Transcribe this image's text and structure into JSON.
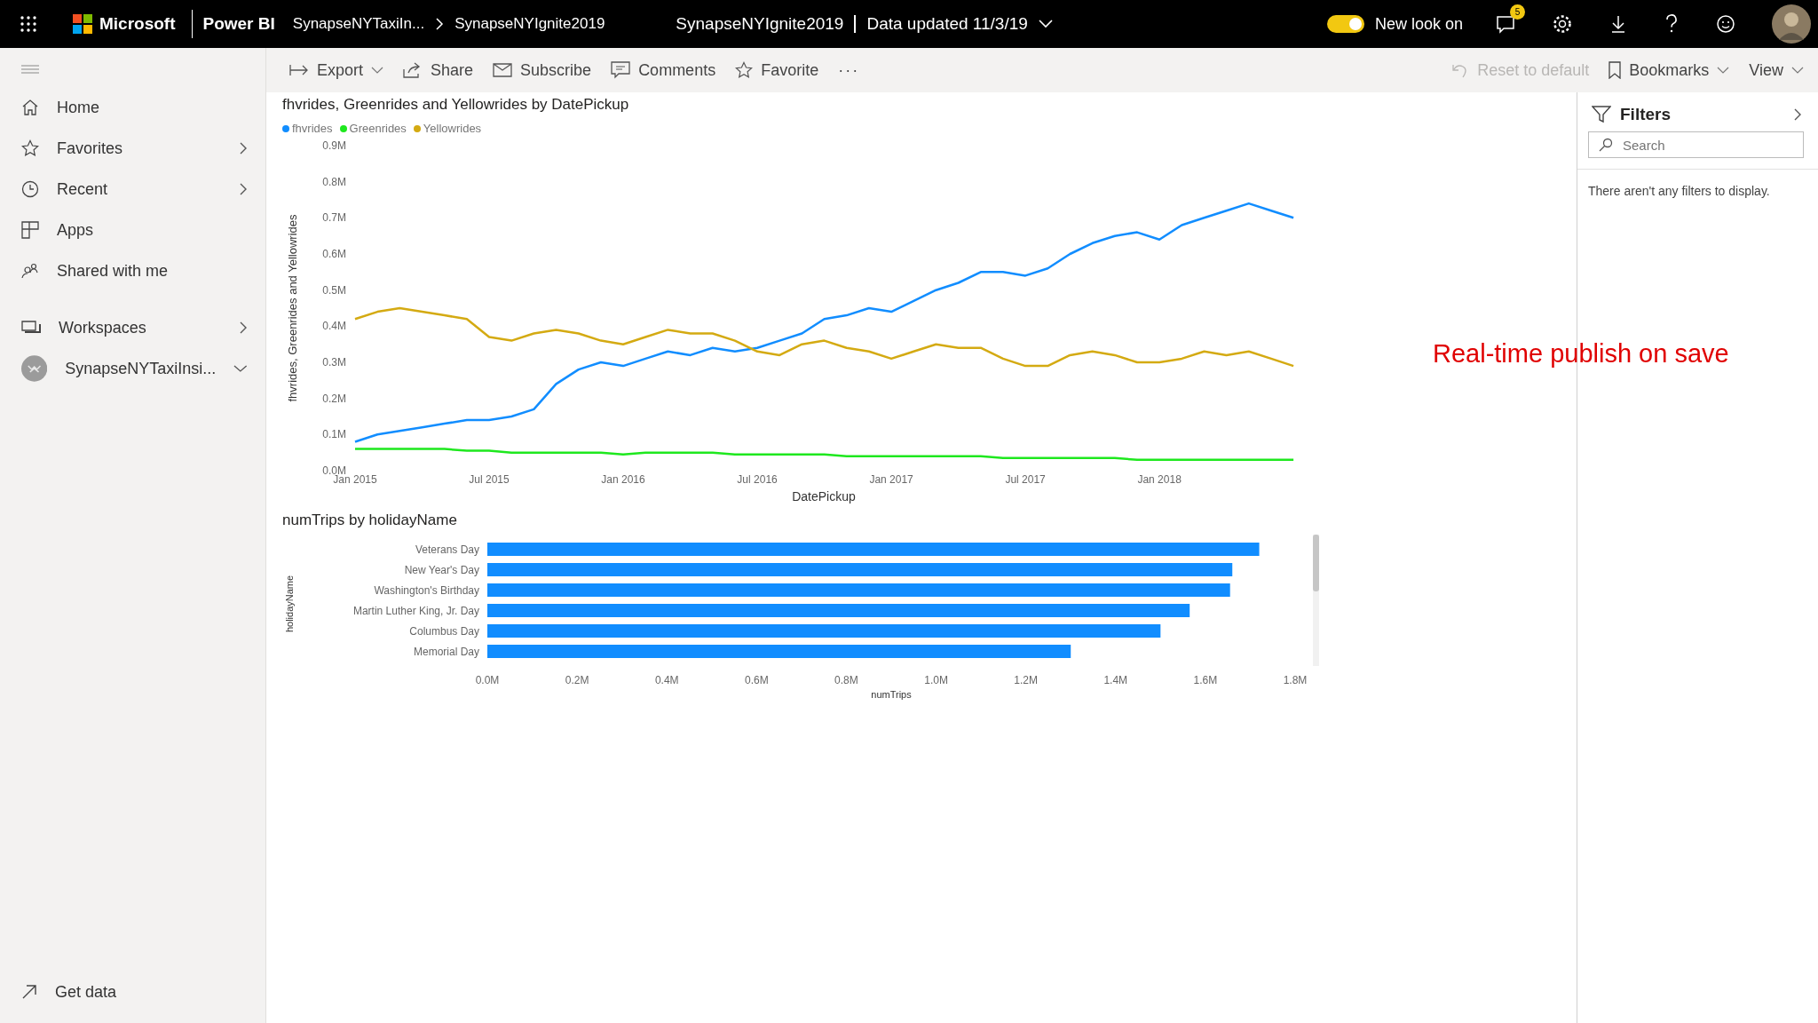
{
  "top_bar": {
    "brand": "Microsoft",
    "product": "Power BI",
    "breadcrumb": [
      "SynapseNYTaxiIn...",
      "SynapseNYIgnite2019"
    ],
    "report_title": "SynapseNYIgnite2019",
    "data_updated": "Data updated 11/3/19",
    "new_look": {
      "label": "New look on",
      "on": true
    },
    "notification_count": "5"
  },
  "sidebar": {
    "items": [
      {
        "label": "Home",
        "has_submenu": false
      },
      {
        "label": "Favorites",
        "has_submenu": true
      },
      {
        "label": "Recent",
        "has_submenu": true
      },
      {
        "label": "Apps",
        "has_submenu": false
      },
      {
        "label": "Shared with me",
        "has_submenu": false
      }
    ],
    "workspaces": {
      "label": "Workspaces",
      "has_submenu": true
    },
    "current_workspace": {
      "label": "SynapseNYTaxiInsi...",
      "expanded": true
    },
    "footer": "Get data"
  },
  "toolbar": {
    "actions": [
      {
        "label": "Export",
        "dropdown": true
      },
      {
        "label": "Share",
        "dropdown": false
      },
      {
        "label": "Subscribe",
        "dropdown": false
      },
      {
        "label": "Comments",
        "dropdown": false
      },
      {
        "label": "Favorite",
        "dropdown": false
      }
    ],
    "more": "···",
    "right_actions": [
      {
        "label": "Reset to default",
        "dropdown": false,
        "disabled": true
      },
      {
        "label": "Bookmarks",
        "dropdown": true,
        "disabled": false
      },
      {
        "label": "View",
        "dropdown": true,
        "disabled": false
      }
    ]
  },
  "report": {
    "line_chart": {
      "chart_data": {
        "type": "line",
        "title": "fhvrides, Greenrides and Yellowrides by DatePickup",
        "xlabel": "DatePickup",
        "ylabel": "fhvrides, Greenrides and Yellowrides",
        "categories": [
          "Jan 2015",
          null,
          null,
          null,
          null,
          null,
          "Jul 2015",
          null,
          null,
          null,
          null,
          null,
          "Jan 2016",
          null,
          null,
          null,
          null,
          null,
          "Jul 2016",
          null,
          null,
          null,
          null,
          null,
          "Jan 2017",
          null,
          null,
          null,
          null,
          null,
          "Jul 2017",
          null,
          null,
          null,
          null,
          null,
          "Jan 2018",
          null,
          null,
          null,
          null,
          null,
          null
        ],
        "series": [
          {
            "name": "fhvrides",
            "color": "#118dff",
            "values": [
              0.08,
              0.1,
              0.11,
              0.12,
              0.13,
              0.14,
              0.14,
              0.15,
              0.17,
              0.24,
              0.28,
              0.3,
              0.29,
              0.31,
              0.33,
              0.32,
              0.34,
              0.33,
              0.34,
              0.36,
              0.38,
              0.42,
              0.43,
              0.45,
              0.44,
              0.47,
              0.5,
              0.52,
              0.55,
              0.55,
              0.54,
              0.56,
              0.6,
              0.63,
              0.65,
              0.66,
              0.64,
              0.68,
              0.7,
              0.72,
              0.74,
              0.72,
              0.7
            ]
          },
          {
            "name": "Greenrides",
            "color": "#1ee81e",
            "values": [
              0.06,
              0.06,
              0.06,
              0.06,
              0.06,
              0.055,
              0.055,
              0.05,
              0.05,
              0.05,
              0.05,
              0.05,
              0.045,
              0.05,
              0.05,
              0.05,
              0.05,
              0.045,
              0.045,
              0.045,
              0.045,
              0.045,
              0.04,
              0.04,
              0.04,
              0.04,
              0.04,
              0.04,
              0.04,
              0.035,
              0.035,
              0.035,
              0.035,
              0.035,
              0.035,
              0.03,
              0.03,
              0.03,
              0.03,
              0.03,
              0.03,
              0.03,
              0.03
            ]
          },
          {
            "name": "Yellowrides",
            "color": "#d4aa12",
            "values": [
              0.42,
              0.44,
              0.45,
              0.44,
              0.43,
              0.42,
              0.37,
              0.36,
              0.38,
              0.39,
              0.38,
              0.36,
              0.35,
              0.37,
              0.39,
              0.38,
              0.38,
              0.36,
              0.33,
              0.32,
              0.35,
              0.36,
              0.34,
              0.33,
              0.31,
              0.33,
              0.35,
              0.34,
              0.34,
              0.31,
              0.29,
              0.29,
              0.32,
              0.33,
              0.32,
              0.3,
              0.3,
              0.31,
              0.33,
              0.32,
              0.33,
              0.31,
              0.29
            ]
          }
        ],
        "ylim": [
          0,
          0.9
        ],
        "yticks": [
          {
            "value": 0,
            "label": "0.0M"
          },
          {
            "value": 0.1,
            "label": "0.1M"
          },
          {
            "value": 0.2,
            "label": "0.2M"
          },
          {
            "value": 0.3,
            "label": "0.3M"
          },
          {
            "value": 0.4,
            "label": "0.4M"
          },
          {
            "value": 0.5,
            "label": "0.5M"
          },
          {
            "value": 0.6,
            "label": "0.6M"
          },
          {
            "value": 0.7,
            "label": "0.7M"
          },
          {
            "value": 0.8,
            "label": "0.8M"
          },
          {
            "value": 0.9,
            "label": "0.9M"
          }
        ]
      }
    },
    "bar_chart": {
      "chart_data": {
        "type": "bar",
        "orientation": "horizontal",
        "title": "numTrips by holidayName",
        "xlabel": "numTrips",
        "ylabel": "holidayName",
        "categories": [
          "Veterans Day",
          "New Year's Day",
          "Washington's Birthday",
          "Martin Luther King, Jr. Day",
          "Columbus Day",
          "Memorial Day"
        ],
        "series": [
          {
            "color": "#118dff",
            "values": [
              1.72,
              1.66,
              1.655,
              1.565,
              1.5,
              1.3
            ]
          }
        ],
        "xlim": [
          0,
          1.8
        ],
        "xticks": [
          {
            "value": 0,
            "label": "0.0M"
          },
          {
            "value": 0.2,
            "label": "0.2M"
          },
          {
            "value": 0.4,
            "label": "0.4M"
          },
          {
            "value": 0.6,
            "label": "0.6M"
          },
          {
            "value": 0.8,
            "label": "0.8M"
          },
          {
            "value": 1,
            "label": "1.0M"
          },
          {
            "value": 1.2,
            "label": "1.2M"
          },
          {
            "value": 1.4,
            "label": "1.4M"
          },
          {
            "value": 1.6,
            "label": "1.6M"
          },
          {
            "value": 1.8,
            "label": "1.8M"
          }
        ]
      }
    },
    "caption": "Real-time publish on save"
  },
  "filters": {
    "title": "Filters",
    "search": {
      "placeholder": "Search"
    },
    "empty_message": "There aren't any filters to display."
  }
}
